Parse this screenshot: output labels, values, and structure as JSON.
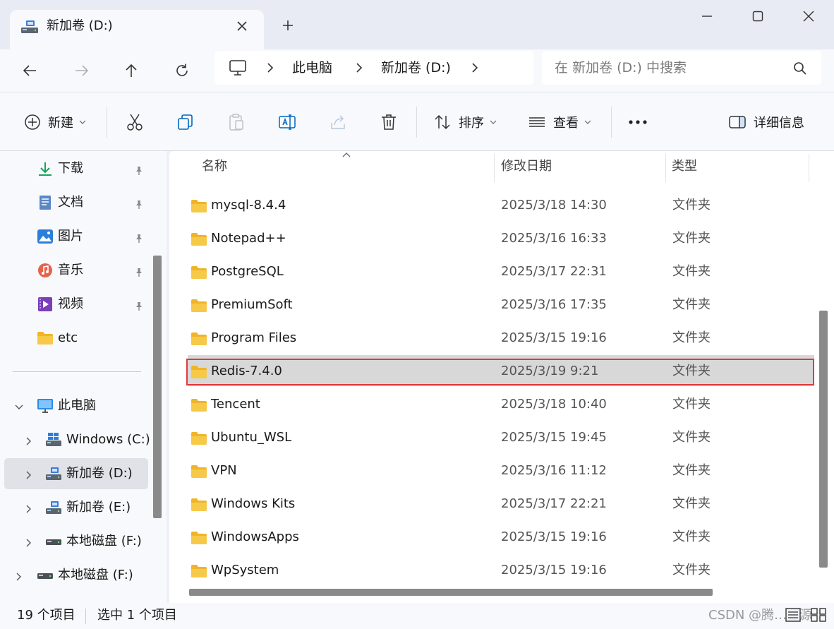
{
  "window": {
    "tab_title": "新加卷 (D:)",
    "tab_icon": "drive-icon",
    "new_tab_icon": "plus-icon",
    "controls": [
      "minimize-icon",
      "maximize-icon",
      "close-icon"
    ]
  },
  "address": {
    "breadcrumb": [
      "此电脑",
      "新加卷 (D:)"
    ],
    "search_placeholder": "在 新加卷 (D:) 中搜索"
  },
  "toolbar": {
    "new_label": "新建",
    "sort_label": "排序",
    "view_label": "查看",
    "details_label": "详细信息"
  },
  "sidebar": {
    "quick_access": [
      {
        "label": "下载",
        "icon": "download-icon"
      },
      {
        "label": "文档",
        "icon": "document-icon"
      },
      {
        "label": "图片",
        "icon": "pictures-icon"
      },
      {
        "label": "音乐",
        "icon": "music-icon"
      },
      {
        "label": "视频",
        "icon": "video-icon"
      },
      {
        "label": "etc",
        "icon": "folder-icon"
      }
    ],
    "tree": [
      {
        "label": "此电脑",
        "icon": "monitor-icon"
      },
      {
        "label": "Windows (C:)",
        "icon": "windows-drive-icon"
      },
      {
        "label": "新加卷 (D:)",
        "icon": "drive-icon"
      },
      {
        "label": "新加卷 (E:)",
        "icon": "drive-icon"
      },
      {
        "label": "本地磁盘 (F:)",
        "icon": "disk-icon"
      },
      {
        "label": "本地磁盘 (F:)",
        "icon": "disk-icon"
      }
    ]
  },
  "files": {
    "columns": {
      "name": "名称",
      "modified": "修改日期",
      "type": "类型"
    },
    "rows": [
      {
        "name": "mysql-8.4.4",
        "modified": "2025/3/18 14:30",
        "type": "文件夹"
      },
      {
        "name": "Notepad++",
        "modified": "2025/3/16 16:33",
        "type": "文件夹"
      },
      {
        "name": "PostgreSQL",
        "modified": "2025/3/17 22:31",
        "type": "文件夹"
      },
      {
        "name": "PremiumSoft",
        "modified": "2025/3/16 17:35",
        "type": "文件夹"
      },
      {
        "name": "Program Files",
        "modified": "2025/3/15 19:16",
        "type": "文件夹"
      },
      {
        "name": "Redis-7.4.0",
        "modified": "2025/3/19 9:21",
        "type": "文件夹"
      },
      {
        "name": "Tencent",
        "modified": "2025/3/18 10:40",
        "type": "文件夹"
      },
      {
        "name": "Ubuntu_WSL",
        "modified": "2025/3/15 19:45",
        "type": "文件夹"
      },
      {
        "name": "VPN",
        "modified": "2025/3/16 11:12",
        "type": "文件夹"
      },
      {
        "name": "Windows Kits",
        "modified": "2025/3/17 22:21",
        "type": "文件夹"
      },
      {
        "name": "WindowsApps",
        "modified": "2025/3/15 19:16",
        "type": "文件夹"
      },
      {
        "name": "WpSystem",
        "modified": "2025/3/15 19:16",
        "type": "文件夹"
      }
    ]
  },
  "status": {
    "item_count": "19 个项目",
    "selection": "选中 1 个项目",
    "watermark": "CSDN @腾…开源"
  },
  "colors": {
    "accent": "#0067c0",
    "folder": "#f7c948",
    "highlight_border": "#e0393e",
    "selected_row": "#d8d8d8"
  }
}
